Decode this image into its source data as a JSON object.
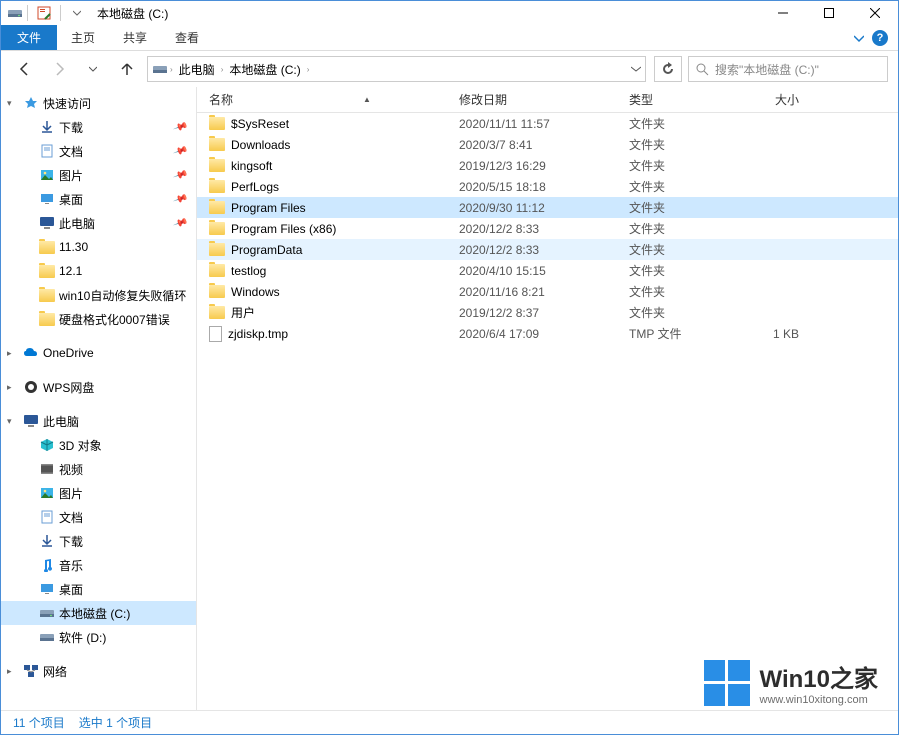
{
  "window": {
    "title": "本地磁盘 (C:)"
  },
  "ribbon": {
    "file": "文件",
    "home": "主页",
    "share": "共享",
    "view": "查看"
  },
  "nav": {
    "crumbs": [
      "此电脑",
      "本地磁盘 (C:)"
    ],
    "search_placeholder": "搜索\"本地磁盘 (C:)\""
  },
  "columns": {
    "name": "名称",
    "date": "修改日期",
    "type": "类型",
    "size": "大小"
  },
  "sidebar": {
    "quick_access": "快速访问",
    "items_quick": [
      {
        "label": "下载",
        "pin": true
      },
      {
        "label": "文档",
        "pin": true
      },
      {
        "label": "图片",
        "pin": true
      },
      {
        "label": "桌面",
        "pin": true
      },
      {
        "label": "此电脑",
        "pin": true
      },
      {
        "label": "11.30",
        "pin": false
      },
      {
        "label": "12.1",
        "pin": false
      },
      {
        "label": "win10自动修复失败循环",
        "pin": false
      },
      {
        "label": "硬盘格式化0007错误",
        "pin": false
      }
    ],
    "onedrive": "OneDrive",
    "wps": "WPS网盘",
    "this_pc": "此电脑",
    "pc_items": [
      "3D 对象",
      "视频",
      "图片",
      "文档",
      "下载",
      "音乐",
      "桌面",
      "本地磁盘 (C:)",
      "软件 (D:)"
    ],
    "network": "网络"
  },
  "files": [
    {
      "name": "$SysReset",
      "date": "2020/11/11 11:57",
      "type": "文件夹",
      "size": "",
      "icon": "folder"
    },
    {
      "name": "Downloads",
      "date": "2020/3/7 8:41",
      "type": "文件夹",
      "size": "",
      "icon": "folder"
    },
    {
      "name": "kingsoft",
      "date": "2019/12/3 16:29",
      "type": "文件夹",
      "size": "",
      "icon": "folder"
    },
    {
      "name": "PerfLogs",
      "date": "2020/5/15 18:18",
      "type": "文件夹",
      "size": "",
      "icon": "folder"
    },
    {
      "name": "Program Files",
      "date": "2020/9/30 11:12",
      "type": "文件夹",
      "size": "",
      "icon": "folder",
      "selected": true
    },
    {
      "name": "Program Files (x86)",
      "date": "2020/12/2 8:33",
      "type": "文件夹",
      "size": "",
      "icon": "folder"
    },
    {
      "name": "ProgramData",
      "date": "2020/12/2 8:33",
      "type": "文件夹",
      "size": "",
      "icon": "folder",
      "hover": true
    },
    {
      "name": "testlog",
      "date": "2020/4/10 15:15",
      "type": "文件夹",
      "size": "",
      "icon": "folder"
    },
    {
      "name": "Windows",
      "date": "2020/11/16 8:21",
      "type": "文件夹",
      "size": "",
      "icon": "folder"
    },
    {
      "name": "用户",
      "date": "2019/12/2 8:37",
      "type": "文件夹",
      "size": "",
      "icon": "folder"
    },
    {
      "name": "zjdiskp.tmp",
      "date": "2020/6/4 17:09",
      "type": "TMP 文件",
      "size": "1 KB",
      "icon": "file"
    }
  ],
  "status": {
    "items": "11 个项目",
    "selected": "选中 1 个项目"
  },
  "watermark": {
    "title": "Win10之家",
    "sub": "www.win10xitong.com"
  }
}
